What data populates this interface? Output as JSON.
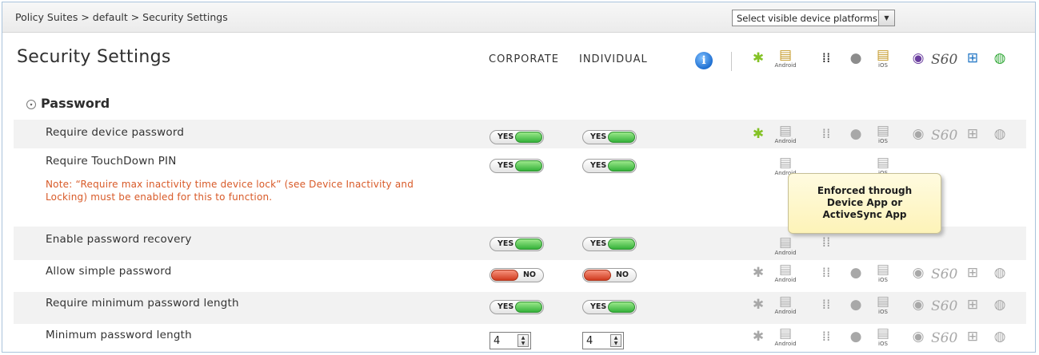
{
  "breadcrumb": "Policy Suites > default > Security Settings",
  "platform_select": {
    "value": "Select visible device platforms",
    "arrow": "▼"
  },
  "title": "Security Settings",
  "columns": {
    "corporate": "CORPORATE",
    "individual": "INDIVIDUAL"
  },
  "info_icon": {
    "glyph": "i",
    "icon": "info-icon"
  },
  "platforms": [
    {
      "icon": "android-robot-icon",
      "glyph": "✱",
      "sub": ""
    },
    {
      "icon": "android-app-icon",
      "glyph": "▤",
      "sub": "Android"
    },
    {
      "icon": "blackberry-icon",
      "glyph": "⁞⁞",
      "sub": ""
    },
    {
      "icon": "apple-icon",
      "glyph": "●",
      "sub": ""
    },
    {
      "icon": "ios-app-icon",
      "glyph": "▤",
      "sub": "iOS"
    },
    {
      "icon": "webos-icon",
      "glyph": "◉",
      "sub": ""
    },
    {
      "icon": "s60-icon",
      "glyph": "S60",
      "sub": ""
    },
    {
      "icon": "windows-icon",
      "glyph": "⊞",
      "sub": ""
    },
    {
      "icon": "globe-icon",
      "glyph": "◍",
      "sub": ""
    }
  ],
  "section": {
    "label": "Password",
    "toggle": "▾"
  },
  "switch_labels": {
    "yes": "YES",
    "no": "NO"
  },
  "rows": [
    {
      "label": "Require device password",
      "corporate": "YES",
      "individual": "YES"
    },
    {
      "label": "Require TouchDown PIN",
      "corporate": "YES",
      "individual": "YES",
      "note": "Note: “Require max inactivity time device lock” (see Device Inactivity and Locking) must be enabled for this to function."
    },
    {
      "label": "Enable password recovery",
      "corporate": "YES",
      "individual": "YES"
    },
    {
      "label": "Allow simple password",
      "corporate": "NO",
      "individual": "NO"
    },
    {
      "label": "Require minimum password length",
      "corporate": "YES",
      "individual": "YES"
    },
    {
      "label": "Minimum password length",
      "corporate": "4",
      "individual": "4"
    }
  ],
  "tooltip": {
    "line1": "Enforced through",
    "line2": "Device App or",
    "line3": "ActiveSync App"
  }
}
